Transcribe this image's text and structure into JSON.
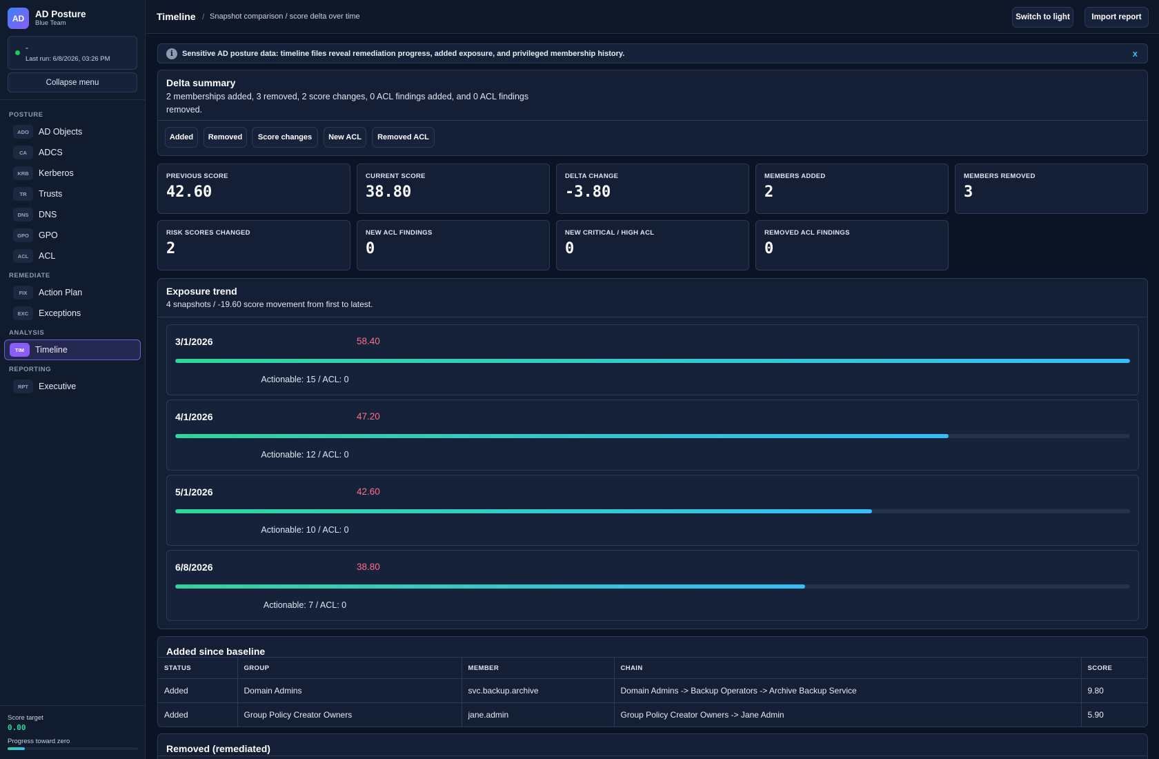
{
  "brand": {
    "logo": "AD",
    "name": "AD Posture",
    "team": "Blue Team"
  },
  "run": {
    "status_title": "-",
    "last_run": "Last run: 6/8/2026, 03:26 PM",
    "status_color": "#22c55e"
  },
  "sidebar": {
    "collapse_label": "Collapse menu",
    "groups": [
      {
        "label": "POSTURE",
        "items": [
          {
            "abbr": "ADO",
            "label": "AD Objects"
          },
          {
            "abbr": "CA",
            "label": "ADCS"
          },
          {
            "abbr": "KRB",
            "label": "Kerberos"
          },
          {
            "abbr": "TR",
            "label": "Trusts"
          },
          {
            "abbr": "DNS",
            "label": "DNS"
          },
          {
            "abbr": "GPO",
            "label": "GPO"
          },
          {
            "abbr": "ACL",
            "label": "ACL"
          }
        ]
      },
      {
        "label": "REMEDIATE",
        "items": [
          {
            "abbr": "FIX",
            "label": "Action Plan"
          },
          {
            "abbr": "EXC",
            "label": "Exceptions"
          }
        ]
      },
      {
        "label": "ANALYSIS",
        "items": [
          {
            "abbr": "TIM",
            "label": "Timeline",
            "active": true
          }
        ]
      },
      {
        "label": "REPORTING",
        "items": [
          {
            "abbr": "RPT",
            "label": "Executive"
          }
        ]
      }
    ],
    "footer": {
      "score_target_label": "Score target",
      "score_target_value": "0.00",
      "progress_label": "Progress toward zero",
      "progress_fraction": 0.13
    }
  },
  "topbar": {
    "title": "Timeline",
    "separator": "/",
    "subtitle": "Snapshot comparison / score delta over time",
    "switch_label": "Switch to light",
    "import_label": "Import report"
  },
  "alert": {
    "icon": "info-icon",
    "text": "Sensitive AD posture data: timeline files reveal remediation progress, added exposure, and privileged membership history.",
    "close": "x"
  },
  "delta": {
    "title": "Delta summary",
    "text": "2 memberships added, 3 removed, 2 score changes, 0 ACL findings added, and 0 ACL findings removed.",
    "chips": [
      "Added",
      "Removed",
      "Score changes",
      "New ACL",
      "Removed ACL"
    ]
  },
  "stats": [
    {
      "label": "PREVIOUS SCORE",
      "value": "42.60"
    },
    {
      "label": "CURRENT SCORE",
      "value": "38.80"
    },
    {
      "label": "DELTA CHANGE",
      "value": "-3.80"
    },
    {
      "label": "MEMBERS ADDED",
      "value": "2"
    },
    {
      "label": "MEMBERS REMOVED",
      "value": "3"
    },
    {
      "label": "RISK SCORES CHANGED",
      "value": "2"
    },
    {
      "label": "NEW ACL FINDINGS",
      "value": "0"
    },
    {
      "label": "NEW CRITICAL / HIGH ACL",
      "value": "0"
    },
    {
      "label": "REMOVED ACL FINDINGS",
      "value": "0"
    }
  ],
  "trend": {
    "title": "Exposure trend",
    "subtitle": "4 snapshots / -19.60 score movement from first to latest.",
    "snapshots": [
      {
        "date": "3/1/2026",
        "score": "58.40",
        "fraction": 1.0,
        "meta": "Actionable: 15 / ACL: 0"
      },
      {
        "date": "4/1/2026",
        "score": "47.20",
        "fraction": 0.81,
        "meta": "Actionable: 12 / ACL: 0"
      },
      {
        "date": "5/1/2026",
        "score": "42.60",
        "fraction": 0.73,
        "meta": "Actionable: 10 / ACL: 0"
      },
      {
        "date": "6/8/2026",
        "score": "38.80",
        "fraction": 0.66,
        "meta": "Actionable: 7 / ACL: 0"
      }
    ]
  },
  "added": {
    "title": "Added since baseline",
    "columns": [
      "STATUS",
      "GROUP",
      "MEMBER",
      "CHAIN",
      "SCORE"
    ],
    "rows": [
      [
        "Added",
        "Domain Admins",
        "svc.backup.archive",
        "Domain Admins -> Backup Operators -> Archive Backup Service",
        "9.80"
      ],
      [
        "Added",
        "Group Policy Creator Owners",
        "jane.admin",
        "Group Policy Creator Owners -> Jane Admin",
        "5.90"
      ]
    ]
  },
  "removed": {
    "title": "Removed (remediated)"
  }
}
